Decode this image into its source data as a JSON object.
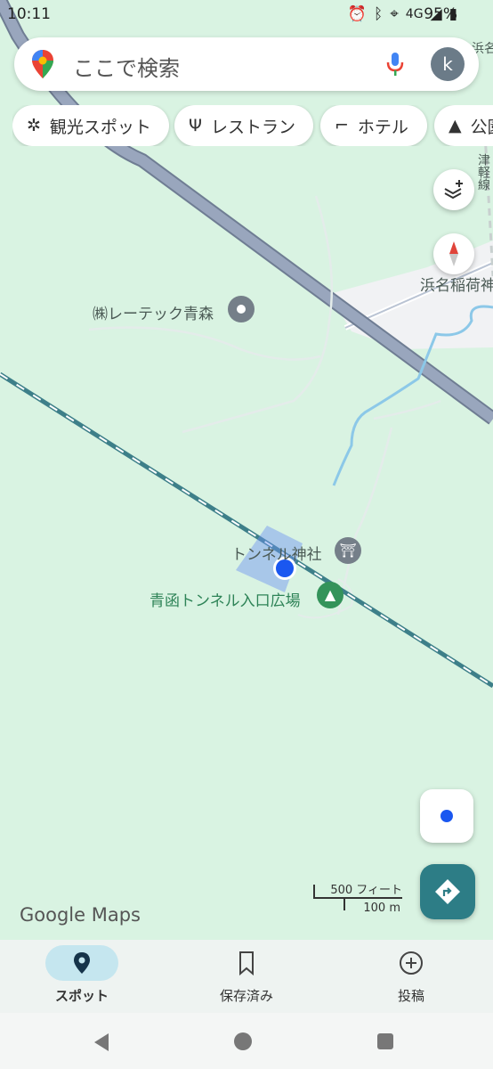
{
  "status_bar": {
    "time": "10:11",
    "network": "4G",
    "battery": "95%"
  },
  "search": {
    "placeholder": "ここで検索",
    "avatar_letter": "k"
  },
  "chips": [
    {
      "label": "観光スポット",
      "icon": "ferris-wheel-icon"
    },
    {
      "label": "レストラン",
      "icon": "fork-knife-icon"
    },
    {
      "label": "ホテル",
      "icon": "bed-icon"
    },
    {
      "label": "公園",
      "icon": "tree-icon"
    }
  ],
  "map_labels": {
    "place1": "㈱レーテック青森",
    "place2": "浜名稲荷神社",
    "railway": "津軽線",
    "shrine": "トンネル神社",
    "park": "青函トンネル入口広場",
    "top_right_fragment": "浜名"
  },
  "scale": {
    "feet": "500 フィート",
    "meters": "100 m"
  },
  "brand": "Google Maps",
  "bottom_tabs": [
    {
      "label": "スポット",
      "icon": "location-pin-icon",
      "active": true
    },
    {
      "label": "保存済み",
      "icon": "bookmark-icon",
      "active": false
    },
    {
      "label": "投稿",
      "icon": "add-circle-icon",
      "active": false
    }
  ],
  "colors": {
    "map_bg": "#d9f3e2",
    "road": "#8e9cb3",
    "railway": "#3d7f89",
    "fab_teal": "#2d7d86",
    "location_blue": "#1a57f0"
  }
}
